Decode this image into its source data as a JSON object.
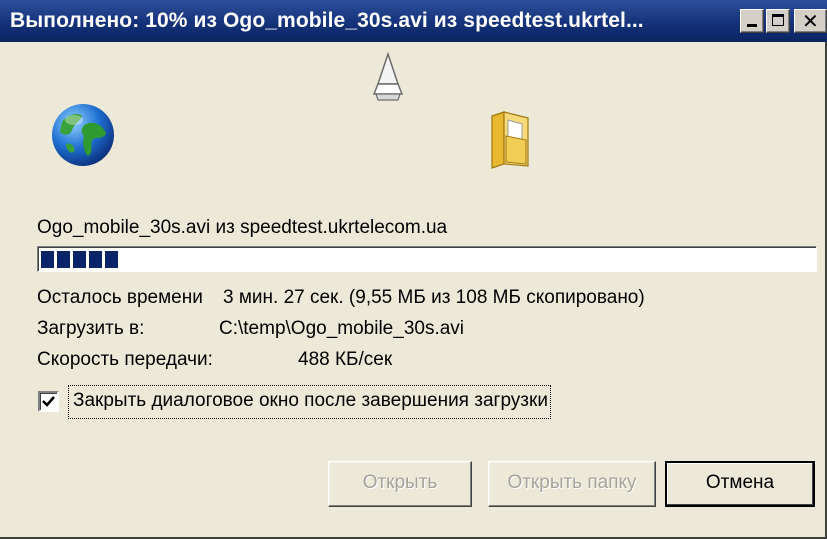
{
  "window": {
    "title": "Выполнено: 10% из Ogo_mobile_30s.avi из speedtest.ukrtel..."
  },
  "file_line": "Ogo_mobile_30s.avi из speedtest.ukrtelecom.ua",
  "progress": {
    "percent": 10,
    "fill_color": "#0a246a"
  },
  "rows": {
    "remaining_label": "Осталось времени",
    "remaining_value": "3 мин. 27 сек. (9,55 МБ из 108 МБ скопировано)",
    "dest_label": "Загрузить в:",
    "dest_value": "C:\\temp\\Ogo_mobile_30s.avi",
    "speed_label": "Скорость передачи:",
    "speed_value": "488 КБ/сек"
  },
  "close_after_download": {
    "checked": true,
    "label": "Закрыть диалоговое окно после завершения загрузки"
  },
  "buttons": {
    "open": "Открыть",
    "open_folder": "Открыть папку",
    "cancel": "Отмена"
  },
  "icons": {
    "globe": "globe-icon",
    "paper": "paper-icon",
    "folder": "folder-icon"
  }
}
